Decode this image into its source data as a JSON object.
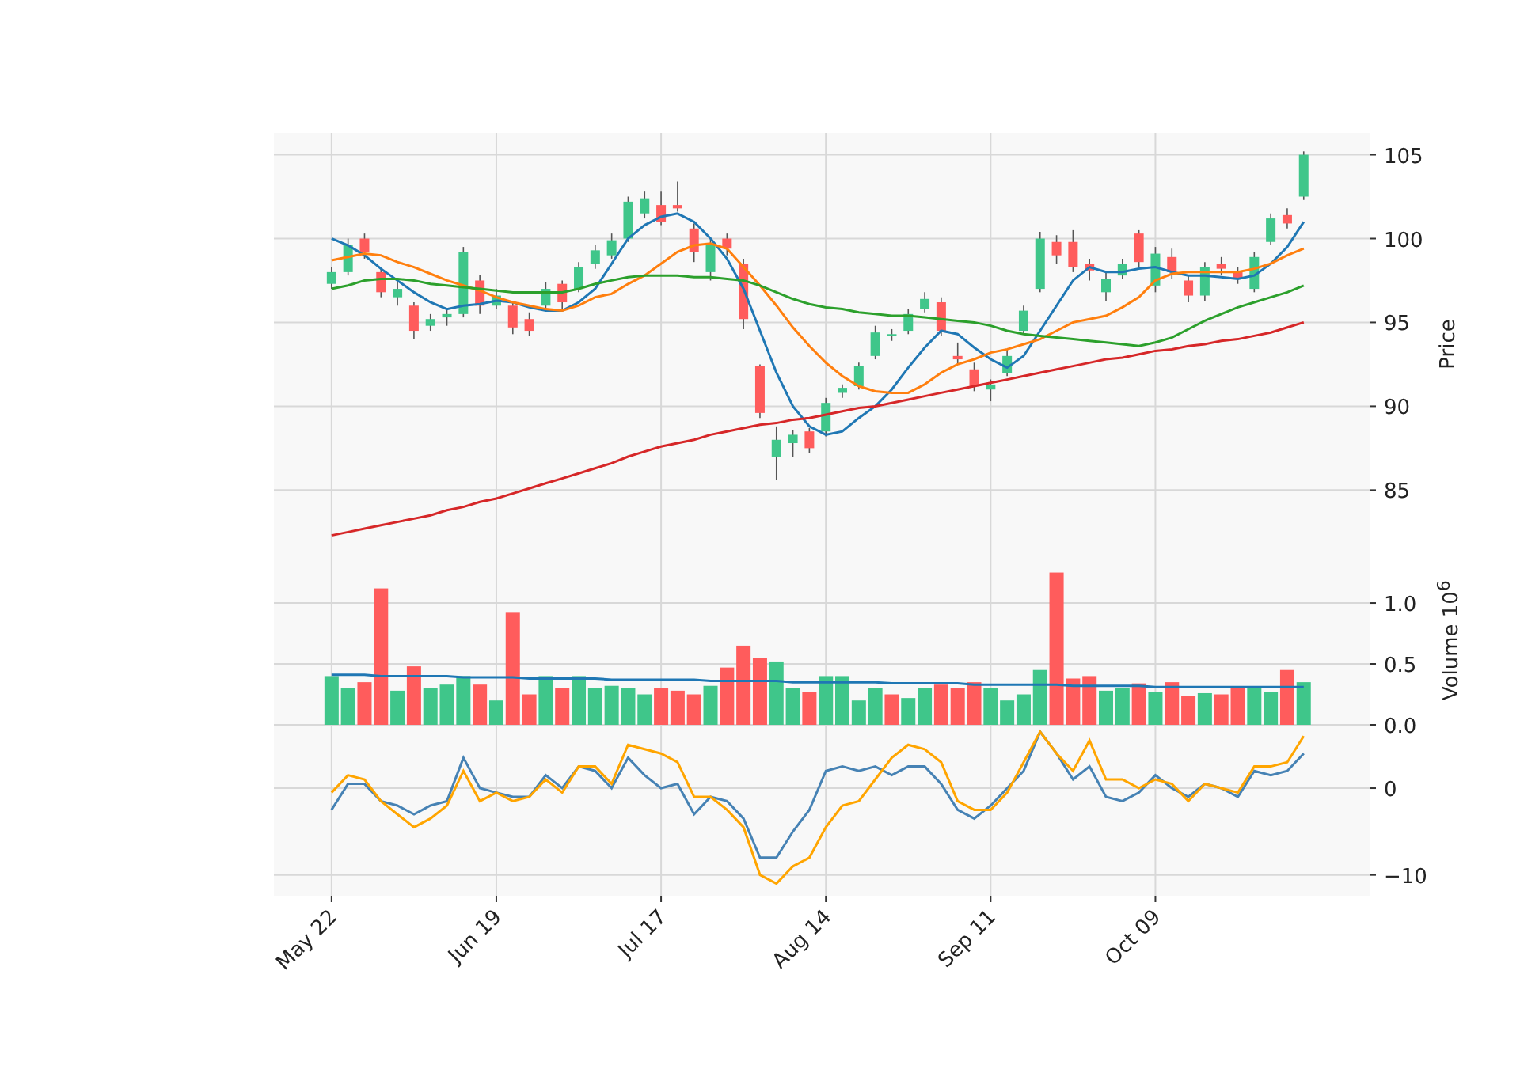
{
  "price_panel": {
    "chart_data": {
      "type": "candlestick",
      "ylabel": "Price",
      "grid": true,
      "ylim": [
        81.1,
        106.3
      ],
      "yticks": [
        85,
        90,
        95,
        100,
        105
      ],
      "categories": [
        null,
        null,
        null,
        null,
        null,
        null,
        null,
        null,
        null,
        null,
        null,
        null,
        null,
        null,
        null,
        null,
        null,
        null,
        null,
        null,
        null,
        null,
        null,
        null,
        null,
        null,
        null,
        null,
        null,
        null,
        null,
        null,
        null,
        null,
        null,
        null,
        null,
        null,
        null,
        null,
        null,
        null,
        null,
        null,
        null,
        null,
        null,
        null,
        null,
        null,
        null,
        null,
        null,
        null,
        null,
        null,
        null,
        null,
        null,
        null
      ],
      "ohlc": [
        [
          97.3,
          98.3,
          97,
          98
        ],
        [
          98,
          100,
          97.8,
          99.6
        ],
        [
          100,
          100.3,
          98.8,
          99.2
        ],
        [
          98,
          98.2,
          96.5,
          96.8
        ],
        [
          96.5,
          97.5,
          96,
          97
        ],
        [
          96,
          96.2,
          94,
          94.5
        ],
        [
          94.8,
          95.5,
          94.5,
          95.2
        ],
        [
          95.3,
          95.8,
          94.8,
          95.5
        ],
        [
          95.5,
          99.5,
          95.3,
          99.2
        ],
        [
          97.5,
          97.8,
          95.5,
          96
        ],
        [
          96,
          97,
          95.8,
          96.6
        ],
        [
          96,
          96.2,
          94.3,
          94.7
        ],
        [
          95.2,
          95.6,
          94.2,
          94.5
        ],
        [
          96,
          97.4,
          95.8,
          97
        ],
        [
          97.3,
          97.5,
          95.8,
          96.2
        ],
        [
          97,
          98.6,
          96.8,
          98.3
        ],
        [
          98.5,
          99.6,
          98.2,
          99.3
        ],
        [
          99,
          100.3,
          98.8,
          99.9
        ],
        [
          100,
          102.5,
          99.8,
          102.2
        ],
        [
          101.5,
          102.8,
          101.2,
          102.4
        ],
        [
          102,
          102.8,
          100.8,
          101
        ],
        [
          102,
          103.4,
          101.6,
          101.8
        ],
        [
          100.6,
          100.9,
          98.6,
          99.2
        ],
        [
          98,
          100,
          97.5,
          99.6
        ],
        [
          100,
          100.3,
          99,
          99.4
        ],
        [
          98.5,
          98.8,
          94.6,
          95.2
        ],
        [
          92.4,
          92.5,
          89.3,
          89.6
        ],
        [
          87,
          88.8,
          85.6,
          88
        ],
        [
          87.8,
          88.6,
          87,
          88.3
        ],
        [
          88.5,
          88.7,
          87.2,
          87.5
        ],
        [
          88.5,
          90.5,
          88.2,
          90.2
        ],
        [
          90.8,
          91.3,
          90.5,
          91.1
        ],
        [
          91.2,
          92.6,
          91,
          92.4
        ],
        [
          93,
          94.8,
          92.8,
          94.4
        ],
        [
          94.2,
          94.6,
          93.9,
          94.3
        ],
        [
          94.5,
          95.8,
          94.3,
          95.5
        ],
        [
          95.8,
          96.8,
          95.6,
          96.4
        ],
        [
          96.2,
          96.5,
          94.2,
          94.5
        ],
        [
          93,
          93.8,
          92.5,
          92.8
        ],
        [
          92.2,
          92.6,
          90.9,
          91.2
        ],
        [
          91,
          91.6,
          90.3,
          91.3
        ],
        [
          92,
          93.4,
          91.8,
          93
        ],
        [
          94.5,
          96,
          94.3,
          95.7
        ],
        [
          97,
          100.4,
          96.8,
          100
        ],
        [
          99.8,
          100.2,
          98.5,
          99
        ],
        [
          99.8,
          100.5,
          98,
          98.3
        ],
        [
          98.5,
          98.8,
          97.5,
          98.1
        ],
        [
          96.8,
          98,
          96.3,
          97.6
        ],
        [
          97.8,
          98.8,
          97.6,
          98.5
        ],
        [
          100.3,
          100.5,
          98.2,
          98.6
        ],
        [
          97.2,
          99.5,
          96.8,
          99.1
        ],
        [
          98.9,
          99.4,
          97.6,
          98
        ],
        [
          97.5,
          97.8,
          96.2,
          96.6
        ],
        [
          96.6,
          98.6,
          96.3,
          98.3
        ],
        [
          98.5,
          98.9,
          97.8,
          98.2
        ],
        [
          98,
          98.3,
          97.3,
          97.6
        ],
        [
          97,
          99.2,
          96.8,
          98.9
        ],
        [
          99.8,
          101.5,
          99.6,
          101.2
        ],
        [
          101.4,
          101.8,
          100.6,
          100.9
        ],
        [
          102.5,
          105.2,
          102.3,
          105
        ]
      ],
      "series": [
        {
          "type": "line",
          "color": "#1f77b4",
          "values": [
            100,
            99.6,
            99,
            98.2,
            97.5,
            96.8,
            96.2,
            95.8,
            96,
            96.1,
            96.3,
            96.2,
            95.9,
            95.7,
            95.7,
            96.2,
            97,
            98.5,
            100,
            100.8,
            101.3,
            101.5,
            101,
            100,
            98.8,
            97,
            94.5,
            92,
            90,
            88.8,
            88.3,
            88.5,
            89.3,
            90,
            91,
            92.3,
            93.5,
            94.5,
            94.3,
            93.5,
            92.8,
            92.3,
            93,
            94.5,
            96,
            97.5,
            98.3,
            98,
            98,
            98.2,
            98.3,
            98,
            97.8,
            97.8,
            97.7,
            97.6,
            97.8,
            98.5,
            99.5,
            101
          ]
        },
        {
          "type": "line",
          "color": "#ff7f0e",
          "values": [
            98.7,
            98.9,
            99.1,
            99,
            98.6,
            98.3,
            97.9,
            97.5,
            97.2,
            96.9,
            96.5,
            96.2,
            96,
            95.8,
            95.7,
            96,
            96.5,
            96.7,
            97.3,
            97.8,
            98.5,
            99.2,
            99.6,
            99.7,
            99.4,
            98.3,
            97.2,
            96,
            94.7,
            93.6,
            92.6,
            91.8,
            91.2,
            90.9,
            90.8,
            90.8,
            91.3,
            92,
            92.5,
            92.8,
            93.2,
            93.4,
            93.7,
            94,
            94.5,
            95,
            95.2,
            95.4,
            95.9,
            96.5,
            97.5,
            97.9,
            98,
            98,
            98,
            98,
            98.2,
            98.5,
            99,
            99.4
          ]
        },
        {
          "type": "line",
          "color": "#2ca02c",
          "values": [
            97,
            97.2,
            97.5,
            97.6,
            97.6,
            97.5,
            97.3,
            97.2,
            97.1,
            97,
            96.9,
            96.8,
            96.8,
            96.8,
            96.8,
            97,
            97.3,
            97.5,
            97.7,
            97.8,
            97.8,
            97.8,
            97.7,
            97.7,
            97.6,
            97.5,
            97.2,
            96.8,
            96.4,
            96.1,
            95.9,
            95.8,
            95.6,
            95.5,
            95.4,
            95.4,
            95.3,
            95.2,
            95.1,
            95,
            94.8,
            94.5,
            94.3,
            94.2,
            94.1,
            94,
            93.9,
            93.8,
            93.7,
            93.6,
            93.8,
            94.1,
            94.6,
            95.1,
            95.5,
            95.9,
            96.2,
            96.5,
            96.8,
            97.2
          ]
        },
        {
          "type": "line",
          "color": "#d62728",
          "values": [
            82.3,
            82.5,
            82.7,
            82.9,
            83.1,
            83.3,
            83.5,
            83.8,
            84,
            84.3,
            84.5,
            84.8,
            85.1,
            85.4,
            85.7,
            86,
            86.3,
            86.6,
            87,
            87.3,
            87.6,
            87.8,
            88,
            88.3,
            88.5,
            88.7,
            88.9,
            89,
            89.2,
            89.3,
            89.5,
            89.7,
            89.9,
            90,
            90.2,
            90.4,
            90.6,
            90.8,
            91,
            91.2,
            91.4,
            91.6,
            91.8,
            92,
            92.2,
            92.4,
            92.6,
            92.8,
            92.9,
            93.1,
            93.3,
            93.4,
            93.6,
            93.7,
            93.9,
            94,
            94.2,
            94.4,
            94.7,
            95
          ]
        }
      ]
    }
  },
  "volume_panel": {
    "chart_data": {
      "type": "bar",
      "ylabel": "Volume  10$^{6}$",
      "grid": true,
      "ylim": [
        0,
        1.39
      ],
      "yticks": [
        {
          "value": 0,
          "label": "0.0"
        },
        {
          "value": 0.5,
          "label": "0.5"
        },
        {
          "value": 1,
          "label": "1.0"
        }
      ],
      "categories": [
        null,
        null,
        null,
        null,
        null,
        null,
        null,
        null,
        null,
        null,
        null,
        null,
        null,
        null,
        null,
        null,
        null,
        null,
        null,
        null,
        null,
        null,
        null,
        null,
        null,
        null,
        null,
        null,
        null,
        null,
        null,
        null,
        null,
        null,
        null,
        null,
        null,
        null,
        null,
        null,
        null,
        null,
        null,
        null,
        null,
        null,
        null,
        null,
        null,
        null,
        null,
        null,
        null,
        null,
        null,
        null,
        null,
        null,
        null,
        null
      ],
      "series": [
        {
          "type": "bar",
          "colors": [
            "#3fc68a",
            "#3fc68a",
            "#ff5c5c",
            "#ff5c5c",
            "#3fc68a",
            "#ff5c5c",
            "#3fc68a",
            "#3fc68a",
            "#3fc68a",
            "#ff5c5c",
            "#3fc68a",
            "#ff5c5c",
            "#ff5c5c",
            "#3fc68a",
            "#ff5c5c",
            "#3fc68a",
            "#3fc68a",
            "#3fc68a",
            "#3fc68a",
            "#3fc68a",
            "#ff5c5c",
            "#ff5c5c",
            "#ff5c5c",
            "#3fc68a",
            "#ff5c5c",
            "#ff5c5c",
            "#ff5c5c",
            "#3fc68a",
            "#3fc68a",
            "#ff5c5c",
            "#3fc68a",
            "#3fc68a",
            "#3fc68a",
            "#3fc68a",
            "#ff5c5c",
            "#3fc68a",
            "#3fc68a",
            "#ff5c5c",
            "#ff5c5c",
            "#ff5c5c",
            "#3fc68a",
            "#3fc68a",
            "#3fc68a",
            "#3fc68a",
            "#ff5c5c",
            "#ff5c5c",
            "#ff5c5c",
            "#3fc68a",
            "#3fc68a",
            "#ff5c5c",
            "#3fc68a",
            "#ff5c5c",
            "#ff5c5c",
            "#3fc68a",
            "#ff5c5c",
            "#ff5c5c",
            "#3fc68a",
            "#3fc68a",
            "#ff5c5c",
            "#3fc68a"
          ],
          "values": [
            0.4,
            0.3,
            0.35,
            1.12,
            0.28,
            0.48,
            0.3,
            0.33,
            0.4,
            0.33,
            0.2,
            0.92,
            0.25,
            0.4,
            0.3,
            0.4,
            0.3,
            0.32,
            0.3,
            0.25,
            0.3,
            0.28,
            0.25,
            0.32,
            0.47,
            0.65,
            0.55,
            0.52,
            0.3,
            0.27,
            0.4,
            0.4,
            0.2,
            0.3,
            0.25,
            0.22,
            0.3,
            0.33,
            0.3,
            0.35,
            0.3,
            0.2,
            0.25,
            0.45,
            1.25,
            0.38,
            0.4,
            0.28,
            0.3,
            0.34,
            0.27,
            0.35,
            0.24,
            0.26,
            0.25,
            0.3,
            0.3,
            0.27,
            0.45,
            0.35
          ]
        },
        {
          "type": "line",
          "color": "#1f77b4",
          "values": [
            0.41,
            0.41,
            0.41,
            0.4,
            0.4,
            0.4,
            0.4,
            0.4,
            0.39,
            0.39,
            0.39,
            0.39,
            0.38,
            0.38,
            0.38,
            0.38,
            0.38,
            0.37,
            0.37,
            0.37,
            0.37,
            0.37,
            0.37,
            0.36,
            0.36,
            0.36,
            0.36,
            0.36,
            0.35,
            0.35,
            0.35,
            0.35,
            0.35,
            0.35,
            0.34,
            0.34,
            0.34,
            0.34,
            0.34,
            0.33,
            0.33,
            0.33,
            0.33,
            0.33,
            0.33,
            0.32,
            0.32,
            0.32,
            0.32,
            0.32,
            0.31,
            0.31,
            0.31,
            0.31,
            0.31,
            0.31,
            0.31,
            0.31,
            0.31,
            0.31
          ]
        }
      ]
    }
  },
  "indicator_panel": {
    "chart_data": {
      "type": "line",
      "grid": true,
      "ylim": [
        -12.4,
        7.3
      ],
      "yticks": [
        {
          "value": -10,
          "label": "−10"
        },
        {
          "value": 0,
          "label": "0"
        }
      ],
      "categories": [
        "May 22",
        null,
        null,
        null,
        null,
        null,
        null,
        null,
        null,
        null,
        "Jun 19",
        null,
        null,
        null,
        null,
        null,
        null,
        null,
        null,
        null,
        "Jul 17",
        null,
        null,
        null,
        null,
        null,
        null,
        null,
        null,
        null,
        "Aug 14",
        null,
        null,
        null,
        null,
        null,
        null,
        null,
        null,
        null,
        "Sep 11",
        null,
        null,
        null,
        null,
        null,
        null,
        null,
        null,
        null,
        "Oct 09",
        null,
        null,
        null,
        null,
        null,
        null,
        null,
        null,
        null
      ],
      "series": [
        {
          "color": "#4682b4",
          "values": [
            -2.5,
            0.5,
            0.5,
            -1.5,
            -2,
            -3,
            -2,
            -1.5,
            3.5,
            0,
            -0.5,
            -1,
            -1,
            1.5,
            0,
            2.5,
            2,
            0,
            3.5,
            1.5,
            0,
            0.5,
            -3,
            -1,
            -1.5,
            -3.5,
            -8,
            -8,
            -5,
            -2.5,
            2,
            2.5,
            2,
            2.5,
            1.5,
            2.5,
            2.5,
            0.5,
            -2.5,
            -3.5,
            -2,
            0,
            2,
            6.5,
            4,
            1,
            2.5,
            -1,
            -1.5,
            -0.5,
            1.5,
            0,
            -1,
            0.5,
            0,
            -1,
            2,
            1.5,
            2,
            4
          ]
        },
        {
          "color": "#ffa500",
          "values": [
            -0.5,
            1.5,
            1,
            -1.5,
            -3,
            -4.5,
            -3.5,
            -2,
            2,
            -1.5,
            -0.5,
            -1.5,
            -1,
            1,
            -0.5,
            2.5,
            2.5,
            0.5,
            5,
            4.5,
            4,
            3,
            -1,
            -1,
            -2.5,
            -4.5,
            -10,
            -11,
            -9,
            -8,
            -4.5,
            -2,
            -1.5,
            1,
            3.5,
            5,
            4.5,
            3,
            -1.5,
            -2.5,
            -2.5,
            -0.5,
            3,
            6.5,
            4,
            2,
            5.5,
            1,
            1,
            0,
            1,
            0.5,
            -1.5,
            0.5,
            0,
            -0.5,
            2.5,
            2.5,
            3,
            6
          ]
        }
      ]
    }
  }
}
